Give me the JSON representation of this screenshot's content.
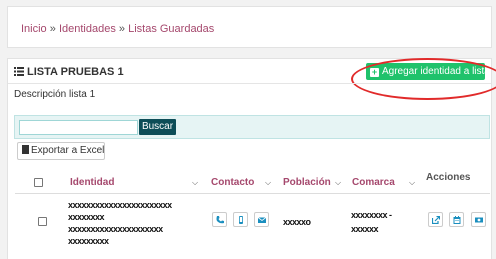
{
  "breadcrumb": {
    "items": [
      "Inicio",
      "Identidades",
      "Listas Guardadas"
    ],
    "separator": "»"
  },
  "list": {
    "title": "LISTA PRUEBAS 1",
    "add_button_label": "Agregar identidad a lista",
    "description": "Descripción lista 1"
  },
  "search": {
    "value": "",
    "button_label": "Buscar"
  },
  "export_label": "Exportar a Excel",
  "table": {
    "headers": [
      "Identidad",
      "Contacto",
      "Población",
      "Comarca",
      "Acciones"
    ],
    "rows": [
      {
        "identidad": [
          "xxxxxxxxxxxxxxxxxxxxxxx",
          "xxxxxxxx",
          "xxxxxxxxxxxxxxxxxxxxx",
          "xxxxxxxxx"
        ],
        "poblacion": "xxxxxo",
        "comarca": [
          "xxxxxxxx -",
          "xxxxxx"
        ]
      }
    ]
  },
  "colors": {
    "accent": "#a5486d",
    "add_button": "#1fc26b",
    "search_button": "#0d4d57",
    "action_icon": "#1b8fbf",
    "highlight": "#e12a2a"
  },
  "icons": {
    "contact": [
      "phone-icon",
      "mobile-icon",
      "envelope-icon"
    ],
    "actions": [
      "external-link-icon",
      "calendar-icon",
      "money-icon"
    ]
  }
}
